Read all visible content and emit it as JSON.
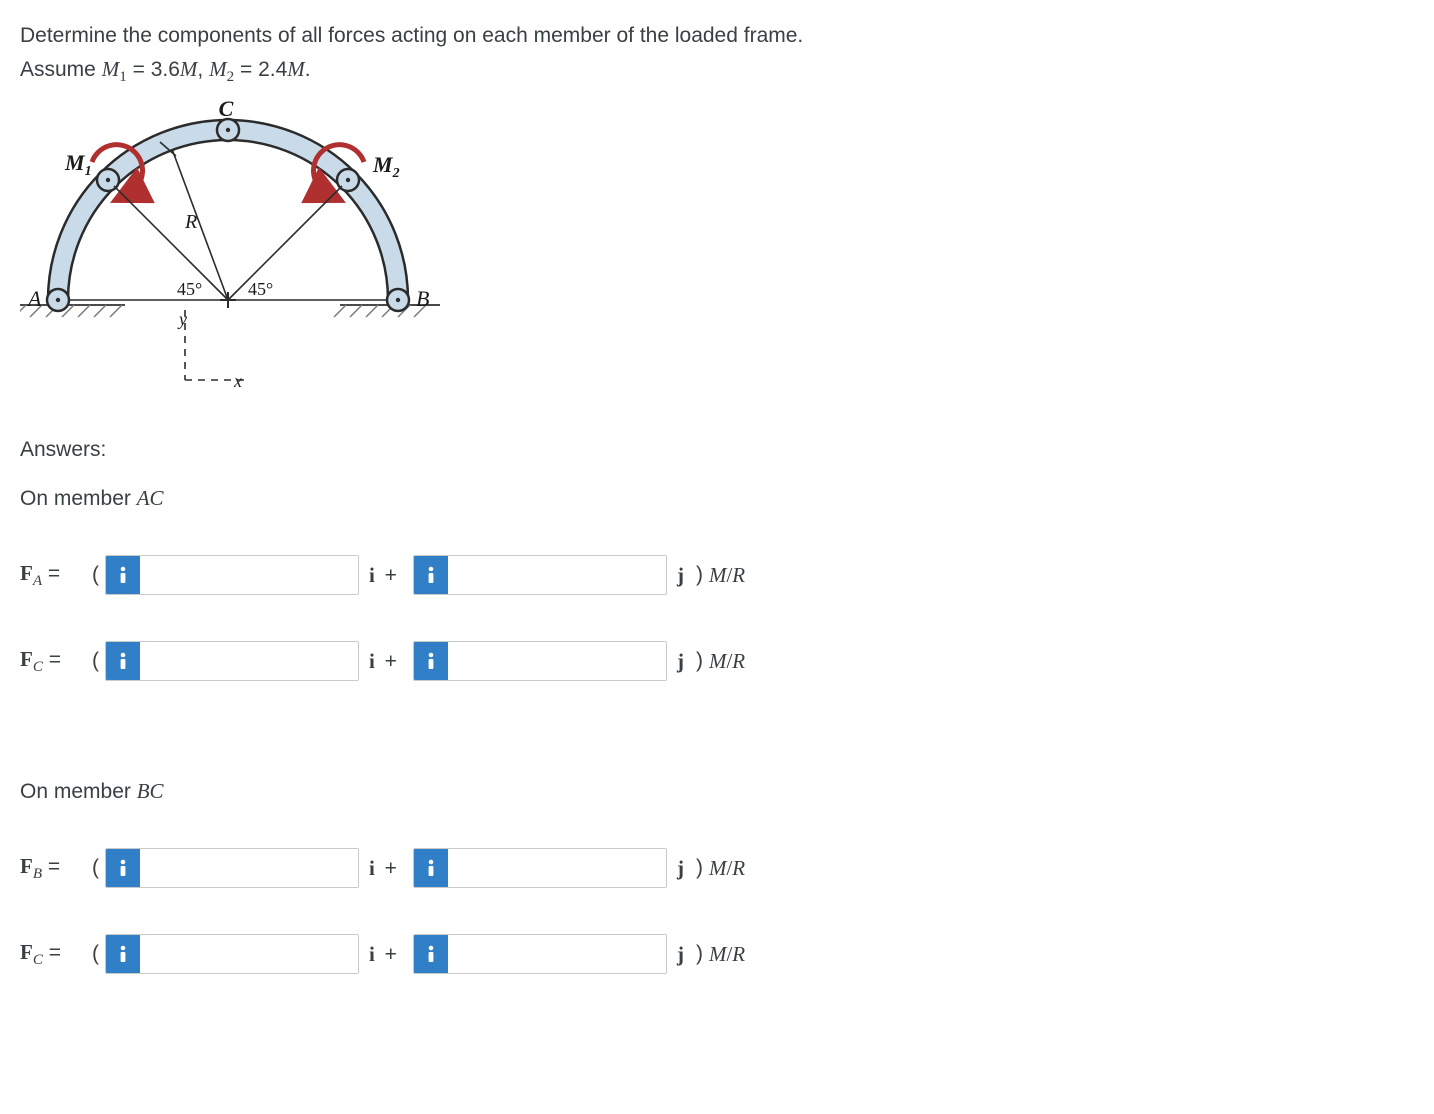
{
  "prompt": {
    "line1": "Determine the components of all forces acting on each member of the loaded frame.",
    "line2_prefix": "Assume ",
    "m1_label": "M",
    "m1_sub": "1",
    "m1_after": " = 3.6",
    "m_italic": "M",
    "m_sep": ", ",
    "m2_label": "M",
    "m2_sub": "2",
    "m2_after": " = 2.4",
    "line2_suffix": "."
  },
  "diagram": {
    "label_C": "C",
    "label_M1": "M",
    "label_M1_sub": "1",
    "label_M2": "M",
    "label_M2_sub": "2",
    "label_R": "R",
    "angle_left": "45°",
    "angle_right": "45°",
    "label_A": "A",
    "label_B": "B",
    "axis_y": "y",
    "axis_x": "x"
  },
  "answers": {
    "title": "Answers:",
    "member_ac": "On member ",
    "member_ac_it": "AC",
    "member_bc": "On member ",
    "member_bc_it": "BC",
    "rows": {
      "ac": [
        {
          "label_main": "F",
          "label_sub": "A",
          "eq": " = "
        },
        {
          "label_main": "F",
          "label_sub": "C",
          "eq": " = "
        }
      ],
      "bc": [
        {
          "label_main": "F",
          "label_sub": "B",
          "eq": " = "
        },
        {
          "label_main": "F",
          "label_sub": "C",
          "eq": " = "
        }
      ]
    },
    "paren_open": "(",
    "i_token": "i",
    "plus_token": " + ",
    "j_token": "j",
    "close_paren": ")",
    "unit_m": "M",
    "unit_slash": "/",
    "unit_r": "R"
  }
}
